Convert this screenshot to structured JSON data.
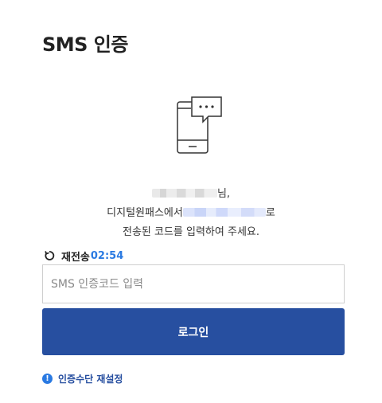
{
  "page": {
    "title": "SMS 인증"
  },
  "message": {
    "name_suffix": "님,",
    "line2_prefix": "디지털원패스에서",
    "line2_suffix": "로",
    "line3": "전송된 코드를 입력하여 주세요."
  },
  "resend": {
    "label": "재전송",
    "timer": "02:54"
  },
  "code_input": {
    "placeholder": "SMS 인증코드 입력",
    "value": ""
  },
  "login_button": {
    "label": "로그인"
  },
  "reset_link": {
    "icon_glyph": "!",
    "label": "인증수단 재설정"
  },
  "colors": {
    "primary": "#274fa0",
    "accent": "#2a7ae2",
    "text": "#222222"
  },
  "icons": [
    "phone-message-icon",
    "refresh-icon",
    "info-icon"
  ]
}
